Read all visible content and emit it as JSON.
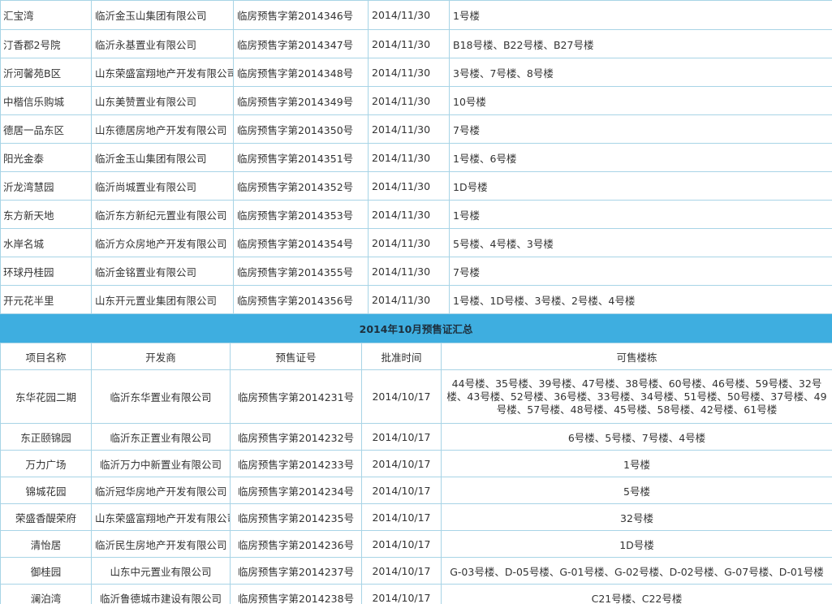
{
  "november": {
    "rows": [
      {
        "project": "汇宝湾",
        "developer": "临沂金玉山集团有限公司",
        "permit": "临房预售字第2014346号",
        "date": "2014/11/30",
        "buildings": "1号楼"
      },
      {
        "project": "汀香郡2号院",
        "developer": "临沂永基置业有限公司",
        "permit": "临房预售字第2014347号",
        "date": "2014/11/30",
        "buildings": "B18号楼、B22号楼、B27号楼"
      },
      {
        "project": "沂河馨苑B区",
        "developer": "山东荣盛富翔地产开发有限公司",
        "permit": "临房预售字第2014348号",
        "date": "2014/11/30",
        "buildings": "3号楼、7号楼、8号楼"
      },
      {
        "project": "中楷信乐购城",
        "developer": "山东美赞置业有限公司",
        "permit": "临房预售字第2014349号",
        "date": "2014/11/30",
        "buildings": "10号楼"
      },
      {
        "project": "德居一品东区",
        "developer": "山东德居房地产开发有限公司",
        "permit": "临房预售字第2014350号",
        "date": "2014/11/30",
        "buildings": "7号楼"
      },
      {
        "project": "阳光金泰",
        "developer": "临沂金玉山集团有限公司",
        "permit": "临房预售字第2014351号",
        "date": "2014/11/30",
        "buildings": "1号楼、6号楼"
      },
      {
        "project": "沂龙湾慧园",
        "developer": "临沂尚城置业有限公司",
        "permit": "临房预售字第2014352号",
        "date": "2014/11/30",
        "buildings": "1D号楼"
      },
      {
        "project": "东方新天地",
        "developer": "临沂东方新纪元置业有限公司",
        "permit": "临房预售字第2014353号",
        "date": "2014/11/30",
        "buildings": "1号楼"
      },
      {
        "project": "水岸名城",
        "developer": "临沂方众房地产开发有限公司",
        "permit": "临房预售字第2014354号",
        "date": "2014/11/30",
        "buildings": "5号楼、4号楼、3号楼"
      },
      {
        "project": "环球丹桂园",
        "developer": "临沂金铭置业有限公司",
        "permit": "临房预售字第2014355号",
        "date": "2014/11/30",
        "buildings": "7号楼"
      },
      {
        "project": "开元花半里",
        "developer": "山东开元置业集团有限公司",
        "permit": "临房预售字第2014356号",
        "date": "2014/11/30",
        "buildings": "1号楼、1D号楼、3号楼、2号楼、4号楼"
      }
    ]
  },
  "october": {
    "title": "2014年10月预售证汇总",
    "headers": {
      "project": "项目名称",
      "developer": "开发商",
      "permit": "预售证号",
      "date": "批准时间",
      "buildings": "可售楼栋"
    },
    "rows": [
      {
        "project": "东华花园二期",
        "developer": "临沂东华置业有限公司",
        "permit": "临房预售字第2014231号",
        "date": "2014/10/17",
        "buildings": "44号楼、35号楼、39号楼、47号楼、38号楼、60号楼、46号楼、59号楼、32号楼、43号楼、52号楼、36号楼、33号楼、34号楼、51号楼、50号楼、37号楼、49号楼、57号楼、48号楼、45号楼、58号楼、42号楼、61号楼"
      },
      {
        "project": "东正颐锦园",
        "developer": "临沂东正置业有限公司",
        "permit": "临房预售字第2014232号",
        "date": "2014/10/17",
        "buildings": "6号楼、5号楼、7号楼、4号楼"
      },
      {
        "project": "万力广场",
        "developer": "临沂万力中新置业有限公司",
        "permit": "临房预售字第2014233号",
        "date": "2014/10/17",
        "buildings": "1号楼"
      },
      {
        "project": "锦城花园",
        "developer": "临沂冠华房地产开发有限公司",
        "permit": "临房预售字第2014234号",
        "date": "2014/10/17",
        "buildings": "5号楼"
      },
      {
        "project": "荣盛香醍荣府",
        "developer": "山东荣盛富翔地产开发有限公司",
        "permit": "临房预售字第2014235号",
        "date": "2014/10/17",
        "buildings": "32号楼"
      },
      {
        "project": "清怡居",
        "developer": "临沂民生房地产开发有限公司",
        "permit": "临房预售字第2014236号",
        "date": "2014/10/17",
        "buildings": "1D号楼"
      },
      {
        "project": "御桂园",
        "developer": "山东中元置业有限公司",
        "permit": "临房预售字第2014237号",
        "date": "2014/10/17",
        "buildings": "G-03号楼、D-05号楼、G-01号楼、G-02号楼、D-02号楼、G-07号楼、D-01号楼"
      },
      {
        "project": "澜泊湾",
        "developer": "临沂鲁德城市建设有限公司",
        "permit": "临房预售字第2014238号",
        "date": "2014/10/17",
        "buildings": "C21号楼、C22号楼"
      }
    ]
  }
}
